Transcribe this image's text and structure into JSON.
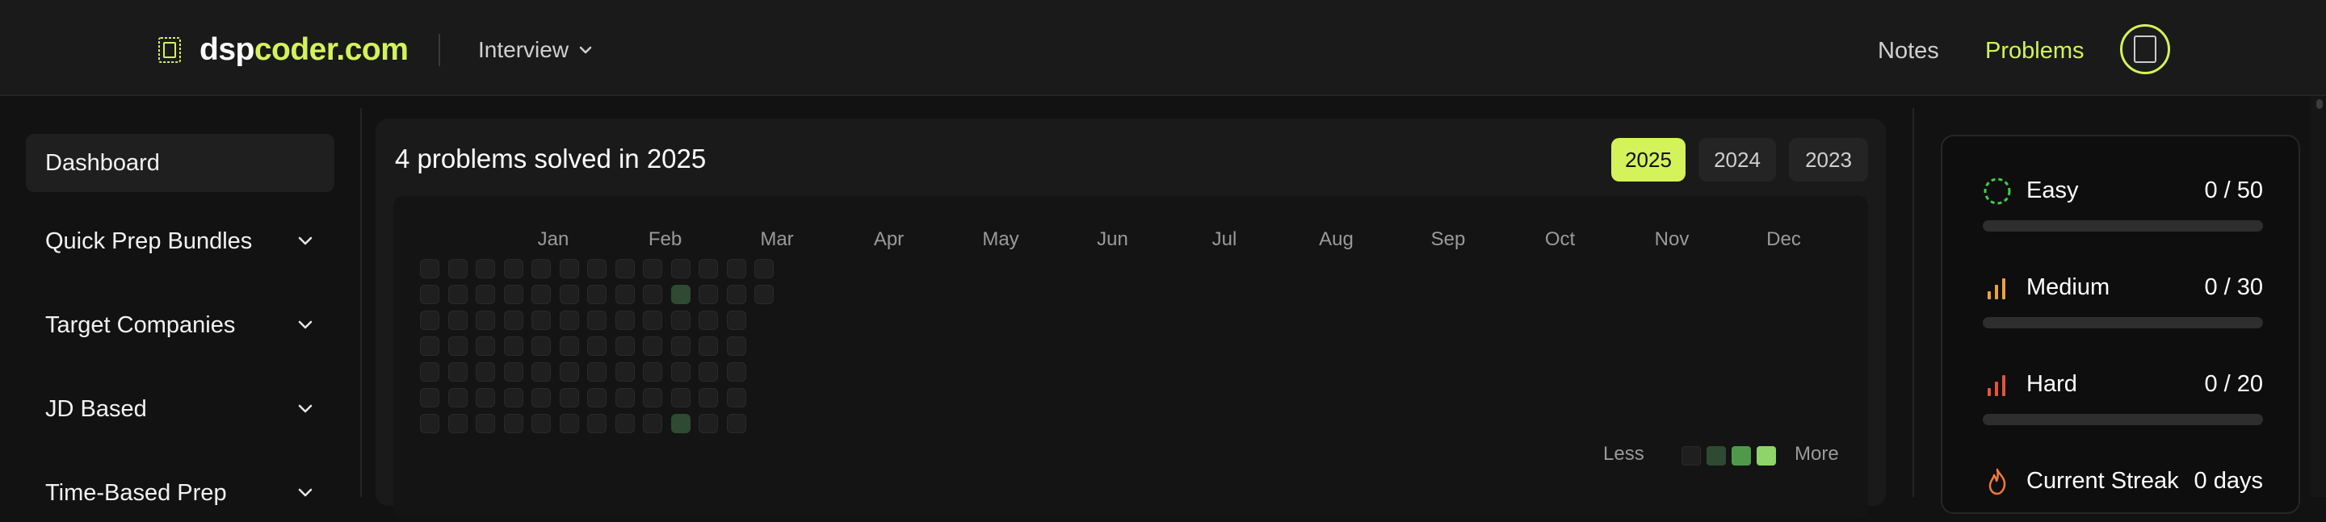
{
  "brand": {
    "part1": "dsp",
    "part2": "coder.com"
  },
  "header": {
    "interview_label": "Interview",
    "nav": {
      "notes": "Notes",
      "problems": "Problems"
    }
  },
  "sidebar": {
    "items": [
      {
        "label": "Dashboard",
        "active": true,
        "expandable": false
      },
      {
        "label": "Quick Prep Bundles",
        "active": false,
        "expandable": true
      },
      {
        "label": "Target Companies",
        "active": false,
        "expandable": true
      },
      {
        "label": "JD Based",
        "active": false,
        "expandable": true
      },
      {
        "label": "Time-Based Prep",
        "active": false,
        "expandable": true
      }
    ]
  },
  "activity": {
    "title": "4 problems solved in 2025",
    "years": [
      {
        "label": "2025",
        "selected": true
      },
      {
        "label": "2024",
        "selected": false
      },
      {
        "label": "2023",
        "selected": false
      }
    ],
    "months": [
      "Jan",
      "Feb",
      "Mar",
      "Apr",
      "May",
      "Jun",
      "Jul",
      "Aug",
      "Sep",
      "Oct",
      "Nov",
      "Dec"
    ],
    "weeks_shown": 13,
    "active_days": [
      {
        "week": 9,
        "weekday": 1,
        "level": 1
      },
      {
        "week": 9,
        "weekday": 6,
        "level": 1
      }
    ],
    "legend": {
      "less": "Less",
      "more": "More",
      "levels": [
        "#1f1f1f",
        "#2f4a32",
        "#4f9a4a",
        "#8fd46a"
      ]
    }
  },
  "stats": {
    "easy": {
      "label": "Easy",
      "value": "0 / 50",
      "solved": 0,
      "total": 50,
      "color": "#3ecf4a"
    },
    "medium": {
      "label": "Medium",
      "value": "0 / 30",
      "solved": 0,
      "total": 30,
      "color": "#e8a33a"
    },
    "hard": {
      "label": "Hard",
      "value": "0 / 20",
      "solved": 0,
      "total": 20,
      "color": "#e5533d"
    },
    "streak": {
      "label": "Current Streak",
      "value": "0 days",
      "color": "#f07a3a"
    }
  },
  "colors": {
    "accent": "#d4f25a",
    "background": "#121212"
  }
}
